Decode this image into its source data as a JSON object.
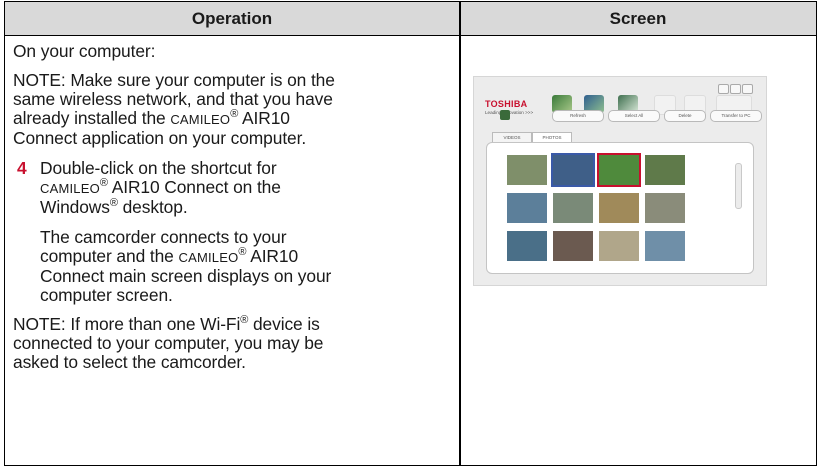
{
  "table": {
    "header_operation": "Operation",
    "header_screen": "Screen"
  },
  "operation": {
    "intro": "On your computer:",
    "note1_a": "NOTE: Make sure your computer is on the",
    "note1_b": "same wireless network, and that you have",
    "note1_c_pre": "already installed the ",
    "note1_c_brand": "CAMILEO",
    "note1_c_reg": "®",
    "note1_c_post": " AIR10",
    "note1_d": "Connect application on your computer.",
    "step_number": "4",
    "step_a": "Double-click on the shortcut for",
    "step_b_brand": "CAMILEO",
    "step_b_reg": "®",
    "step_b_post": " AIR10 Connect on the",
    "step_c_pre": "Windows",
    "step_c_reg": "®",
    "step_c_post": " desktop.",
    "result_a": "The camcorder connects to your",
    "result_b_pre": "computer and the ",
    "result_b_brand": "CAMILEO",
    "result_b_reg": "®",
    "result_b_post": " AIR10",
    "result_c": "Connect main screen displays on your",
    "result_d": "computer screen.",
    "note2_a_pre": "NOTE: If more than one Wi-Fi",
    "note2_a_reg": "®",
    "note2_a_post": " device is",
    "note2_b": "connected to your computer, you may be",
    "note2_c": "asked to select the camcorder."
  },
  "screenshot": {
    "brand": "TOSHIBA",
    "tagline": "Leading Innovation >>>",
    "toolbar_labels": [
      "Preview",
      "Camera",
      "Video Call"
    ],
    "buttons": [
      "Refresh",
      "Select All",
      "Delete",
      "Transfer to PC"
    ],
    "tabs": [
      "VIDEOS",
      "PHOTOS"
    ],
    "colors": {
      "brand_red": "#c8102e",
      "photo_thumbs": [
        "#7f8f6a",
        "#3f5f88",
        "#4f8a3c",
        "#5f7a4a",
        "#5c7f9a",
        "#7a8a78",
        "#a08a5a",
        "#8a8c7a",
        "#4a6f88",
        "#6b5a50",
        "#b0a68a",
        "#6f8fa8"
      ]
    }
  }
}
